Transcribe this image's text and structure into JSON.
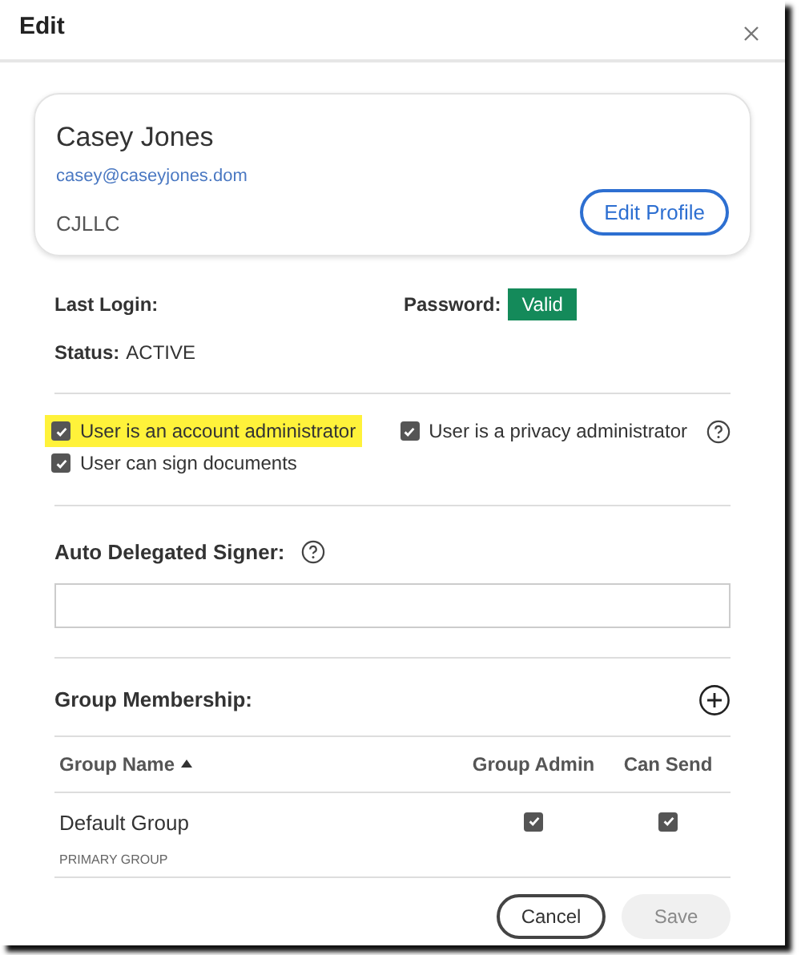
{
  "dialog": {
    "title": "Edit"
  },
  "profile": {
    "name": "Casey Jones",
    "email": "casey@caseyjones.dom",
    "company": "CJLLC",
    "edit_button": "Edit Profile"
  },
  "info": {
    "last_login_label": "Last Login:",
    "password_label": "Password:",
    "password_badge": "Valid",
    "status_label": "Status:",
    "status_value": "ACTIVE"
  },
  "options": [
    {
      "label": "User is an account administrator",
      "checked": true,
      "highlighted": true,
      "help": false
    },
    {
      "label": "User is a privacy administrator",
      "checked": true,
      "highlighted": false,
      "help": true
    },
    {
      "label": "User can sign documents",
      "checked": true,
      "highlighted": false,
      "help": false
    }
  ],
  "delegated_signer": {
    "label": "Auto Delegated Signer:"
  },
  "groups": {
    "label": "Group Membership:",
    "columns": [
      {
        "label": "Group Name",
        "sorted": true
      },
      {
        "label": "Group Admin",
        "sorted": false
      },
      {
        "label": "Can Send",
        "sorted": false
      }
    ],
    "rows": [
      {
        "name": "Default Group",
        "note": "PRIMARY GROUP",
        "admin": true,
        "can_send": true
      }
    ]
  },
  "buttons": [
    {
      "label": "Cancel",
      "kind": "secondary",
      "disabled": false
    },
    {
      "label": "Save",
      "kind": "primary",
      "disabled": true
    }
  ]
}
